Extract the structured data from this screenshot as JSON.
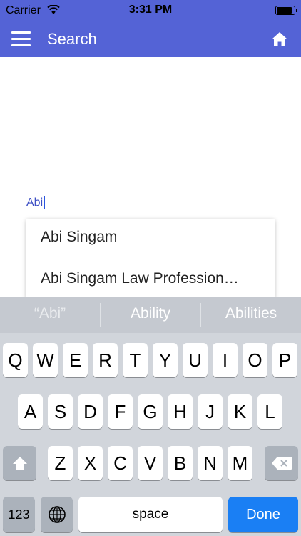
{
  "status_bar": {
    "carrier": "Carrier",
    "time": "3:31 PM",
    "battery_level": 0.95
  },
  "nav": {
    "title": "Search",
    "menu_icon": "menu-icon",
    "home_icon": "home-icon"
  },
  "search": {
    "value": "Abi",
    "placeholder": ""
  },
  "suggestions": [
    "Abi Singam",
    "Abi Singam Law Profession…"
  ],
  "keyboard": {
    "predictions": [
      "“Abi”",
      "Ability",
      "Abilities"
    ],
    "row1": [
      "Q",
      "W",
      "E",
      "R",
      "T",
      "Y",
      "U",
      "I",
      "O",
      "P"
    ],
    "row2": [
      "A",
      "S",
      "D",
      "F",
      "G",
      "H",
      "J",
      "K",
      "L"
    ],
    "row3": [
      "Z",
      "X",
      "C",
      "V",
      "B",
      "N",
      "M"
    ],
    "numbers_label": "123",
    "space_label": "space",
    "done_label": "Done"
  },
  "colors": {
    "nav_bg": "#5463d6",
    "done_key": "#1a7ff4",
    "keyboard_bg": "#d1d5db"
  }
}
